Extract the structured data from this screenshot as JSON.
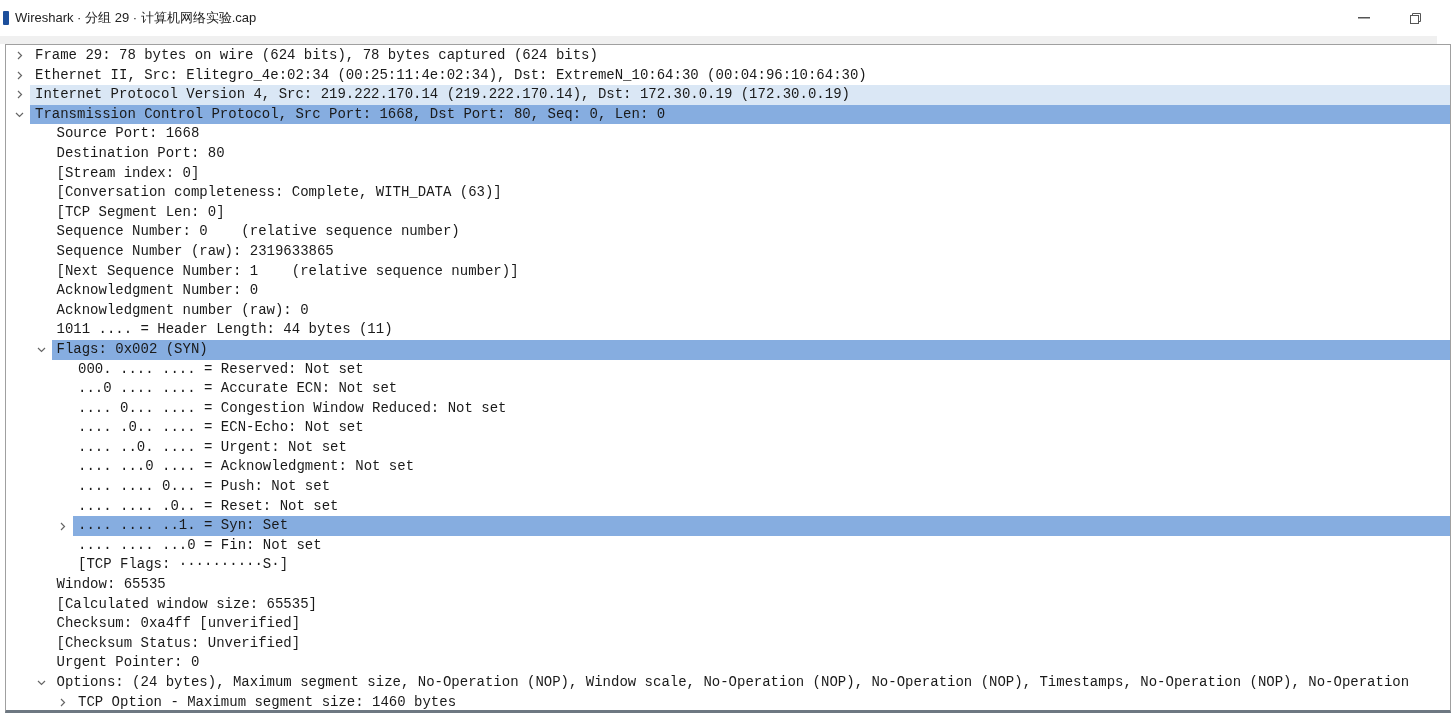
{
  "window": {
    "title": "Wireshark · 分组 29 · 计算机网络实验.cap"
  },
  "tree": [
    {
      "text": "Frame 29: 78 bytes on wire (624 bits), 78 bytes captured (624 bits)",
      "expanded": false,
      "selected": false,
      "hovered": false
    },
    {
      "text": "Ethernet II, Src: Elitegro_4e:02:34 (00:25:11:4e:02:34), Dst: ExtremeN_10:64:30 (00:04:96:10:64:30)",
      "expanded": false,
      "selected": false,
      "hovered": false
    },
    {
      "text": "Internet Protocol Version 4, Src: 219.222.170.14 (219.222.170.14), Dst: 172.30.0.19 (172.30.0.19)",
      "expanded": false,
      "selected": false,
      "hovered": true
    },
    {
      "text": "Transmission Control Protocol, Src Port: 1668, Dst Port: 80, Seq: 0, Len: 0",
      "expanded": true,
      "selected": true,
      "hovered": false,
      "children": [
        {
          "text": "Source Port: 1668",
          "selected": false,
          "hovered": false
        },
        {
          "text": "Destination Port: 80",
          "selected": false,
          "hovered": false
        },
        {
          "text": "[Stream index: 0]",
          "selected": false,
          "hovered": false
        },
        {
          "text": "[Conversation completeness: Complete, WITH_DATA (63)]",
          "selected": false,
          "hovered": false
        },
        {
          "text": "[TCP Segment Len: 0]",
          "selected": false,
          "hovered": false
        },
        {
          "text": "Sequence Number: 0    (relative sequence number)",
          "selected": false,
          "hovered": false
        },
        {
          "text": "Sequence Number (raw): 2319633865",
          "selected": false,
          "hovered": false
        },
        {
          "text": "[Next Sequence Number: 1    (relative sequence number)]",
          "selected": false,
          "hovered": false
        },
        {
          "text": "Acknowledgment Number: 0",
          "selected": false,
          "hovered": false
        },
        {
          "text": "Acknowledgment number (raw): 0",
          "selected": false,
          "hovered": false
        },
        {
          "text": "1011 .... = Header Length: 44 bytes (11)",
          "selected": false,
          "hovered": false
        },
        {
          "text": "Flags: 0x002 (SYN)",
          "expanded": true,
          "selected": true,
          "hovered": false,
          "children": [
            {
              "text": "000. .... .... = Reserved: Not set",
              "selected": false,
              "hovered": false
            },
            {
              "text": "...0 .... .... = Accurate ECN: Not set",
              "selected": false,
              "hovered": false
            },
            {
              "text": ".... 0... .... = Congestion Window Reduced: Not set",
              "selected": false,
              "hovered": false
            },
            {
              "text": ".... .0.. .... = ECN-Echo: Not set",
              "selected": false,
              "hovered": false
            },
            {
              "text": ".... ..0. .... = Urgent: Not set",
              "selected": false,
              "hovered": false
            },
            {
              "text": ".... ...0 .... = Acknowledgment: Not set",
              "selected": false,
              "hovered": false
            },
            {
              "text": ".... .... 0... = Push: Not set",
              "selected": false,
              "hovered": false
            },
            {
              "text": ".... .... .0.. = Reset: Not set",
              "selected": false,
              "hovered": false
            },
            {
              "text": ".... .... ..1. = Syn: Set",
              "expanded": false,
              "selected": true,
              "hovered": false
            },
            {
              "text": ".... .... ...0 = Fin: Not set",
              "selected": false,
              "hovered": false
            },
            {
              "text": "[TCP Flags: ··········S·]",
              "selected": false,
              "hovered": false
            }
          ]
        },
        {
          "text": "Window: 65535",
          "selected": false,
          "hovered": false
        },
        {
          "text": "[Calculated window size: 65535]",
          "selected": false,
          "hovered": false
        },
        {
          "text": "Checksum: 0xa4ff [unverified]",
          "selected": false,
          "hovered": false
        },
        {
          "text": "[Checksum Status: Unverified]",
          "selected": false,
          "hovered": false
        },
        {
          "text": "Urgent Pointer: 0",
          "selected": false,
          "hovered": false
        },
        {
          "text": "Options: (24 bytes), Maximum segment size, No-Operation (NOP), Window scale, No-Operation (NOP), No-Operation (NOP), Timestamps, No-Operation (NOP), No-Operation",
          "expanded": true,
          "selected": false,
          "hovered": false,
          "children": [
            {
              "text": "TCP Option - Maximum segment size: 1460 bytes",
              "expanded": false,
              "selected": false,
              "hovered": false
            }
          ]
        }
      ]
    }
  ]
}
